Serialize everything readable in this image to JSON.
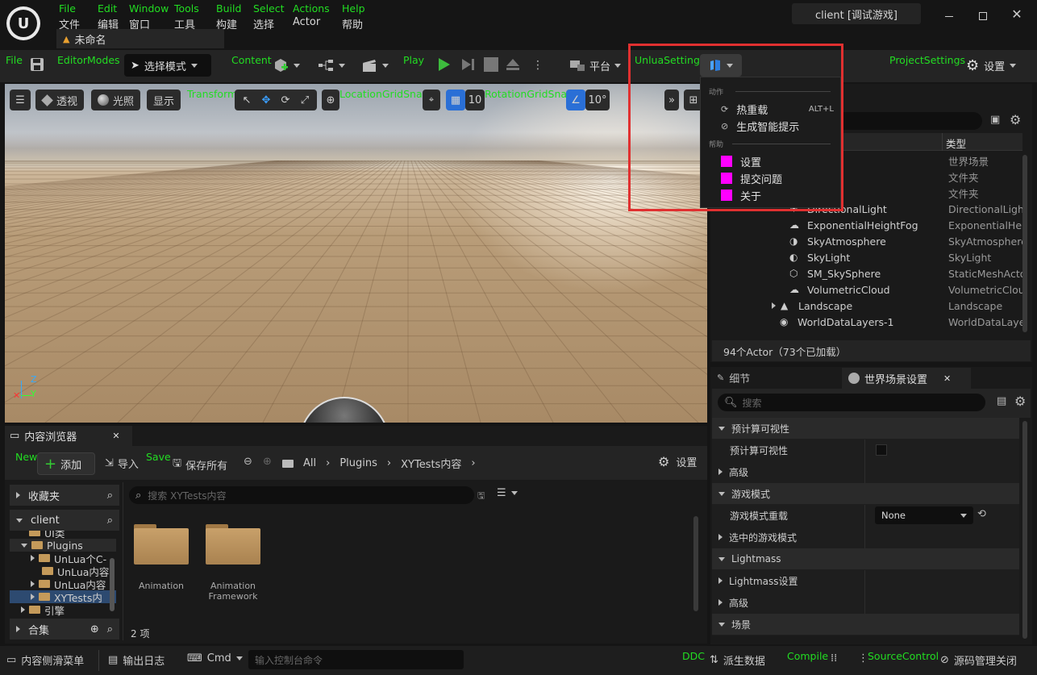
{
  "window": {
    "menu_top": [
      "File",
      "Edit",
      "Window",
      "Tools",
      "Build",
      "Select",
      "Actions",
      "Help"
    ],
    "menu_bottom": [
      "文件",
      "编辑",
      "窗口",
      "工具",
      "构建",
      "选择",
      "Actor",
      "帮助"
    ],
    "tab_title": "未命名",
    "title": "client [调试游戏]"
  },
  "toolbar": {
    "file_label": "File",
    "editor_modes_label": "EditorModes",
    "select_mode": "选择模式",
    "content_label": "Content",
    "play_label": "Play",
    "platform": "平台",
    "unlua_label": "UnluaSettings",
    "project_settings_label": "ProjectSettings",
    "settings": "设置"
  },
  "dropdown": {
    "section_actions": "动作",
    "hot_reload": "热重载",
    "hot_reload_shortcut": "ALT+L",
    "gen_hint": "生成智能提示",
    "section_help": "帮助",
    "settings": "设置",
    "report": "提交问题",
    "about": "关于",
    "accent": "#ff00ff",
    "highlight": "#e03030"
  },
  "viewport": {
    "perspective": "透视",
    "lit": "光照",
    "show": "显示",
    "transform_label": "Transform",
    "location_label": "LocationGridSnap",
    "grid_value": "10",
    "rotation_label": "RotationGridSnap",
    "rotation_value": "10°",
    "axis_z": "Z",
    "axis_y": "Y"
  },
  "outliner": {
    "col_type": "类型",
    "rows": [
      {
        "name": "辑器）",
        "type": "世界场景"
      },
      {
        "name": "",
        "type": "文件夹"
      },
      {
        "name": "",
        "type": "文件夹"
      },
      {
        "name": "DirectionalLight",
        "type": "DirectionalLight"
      },
      {
        "name": "ExponentialHeightFog",
        "type": "ExponentialHei"
      },
      {
        "name": "SkyAtmosphere",
        "type": "SkyAtmosphere"
      },
      {
        "name": "SkyLight",
        "type": "SkyLight"
      },
      {
        "name": "SM_SkySphere",
        "type": "StaticMeshActo"
      },
      {
        "name": "VolumetricCloud",
        "type": "VolumetricClou"
      },
      {
        "name": "Landscape",
        "type": "Landscape"
      },
      {
        "name": "WorldDataLayers-1",
        "type": "WorldDataLaye"
      }
    ],
    "status": "94个Actor（73个已加载）"
  },
  "details": {
    "tab_details": "细节",
    "tab_world": "世界场景设置",
    "search_placeholder": "搜索",
    "rows": [
      {
        "kind": "header",
        "label": "预计算可视性"
      },
      {
        "kind": "prop",
        "label": "预计算可视性"
      },
      {
        "kind": "collapsed",
        "label": "高级"
      },
      {
        "kind": "header",
        "label": "游戏模式"
      },
      {
        "kind": "prop",
        "label": "游戏模式重载"
      },
      {
        "kind": "collapsed",
        "label": "选中的游戏模式"
      },
      {
        "kind": "header",
        "label": "Lightmass"
      },
      {
        "kind": "collapsed",
        "label": "Lightmass设置"
      },
      {
        "kind": "collapsed",
        "label": "高级"
      },
      {
        "kind": "header",
        "label": "场景"
      }
    ],
    "gamemode_value": "None"
  },
  "content_browser": {
    "tab": "内容浏览器",
    "new_label": "New",
    "add": "添加",
    "import": "导入",
    "save_label": "Save",
    "save_all": "保存所有",
    "crumbs": [
      "All",
      "Plugins",
      "XYTests内容"
    ],
    "settings": "设置",
    "favorites": "收藏夹",
    "project": "client",
    "tree": [
      "UI类",
      "Plugins",
      "UnLua个C-",
      "UnLua内容",
      "UnLua内容",
      "XYTests内",
      "引擎"
    ],
    "collections": "合集",
    "search_placeholder": "搜索 XYTests内容",
    "folders": [
      "Animation",
      "Animation Framework"
    ],
    "count": "2 项"
  },
  "statusbar": {
    "drawer": "内容侧滑菜单",
    "output_log": "输出日志",
    "cmd": "Cmd",
    "console_placeholder": "输入控制台命令",
    "ddc_label": "DDC",
    "derived": "派生数据",
    "compile_label": "Compile",
    "source_label": "SourceControl",
    "source_status": "源码管理关闭"
  }
}
